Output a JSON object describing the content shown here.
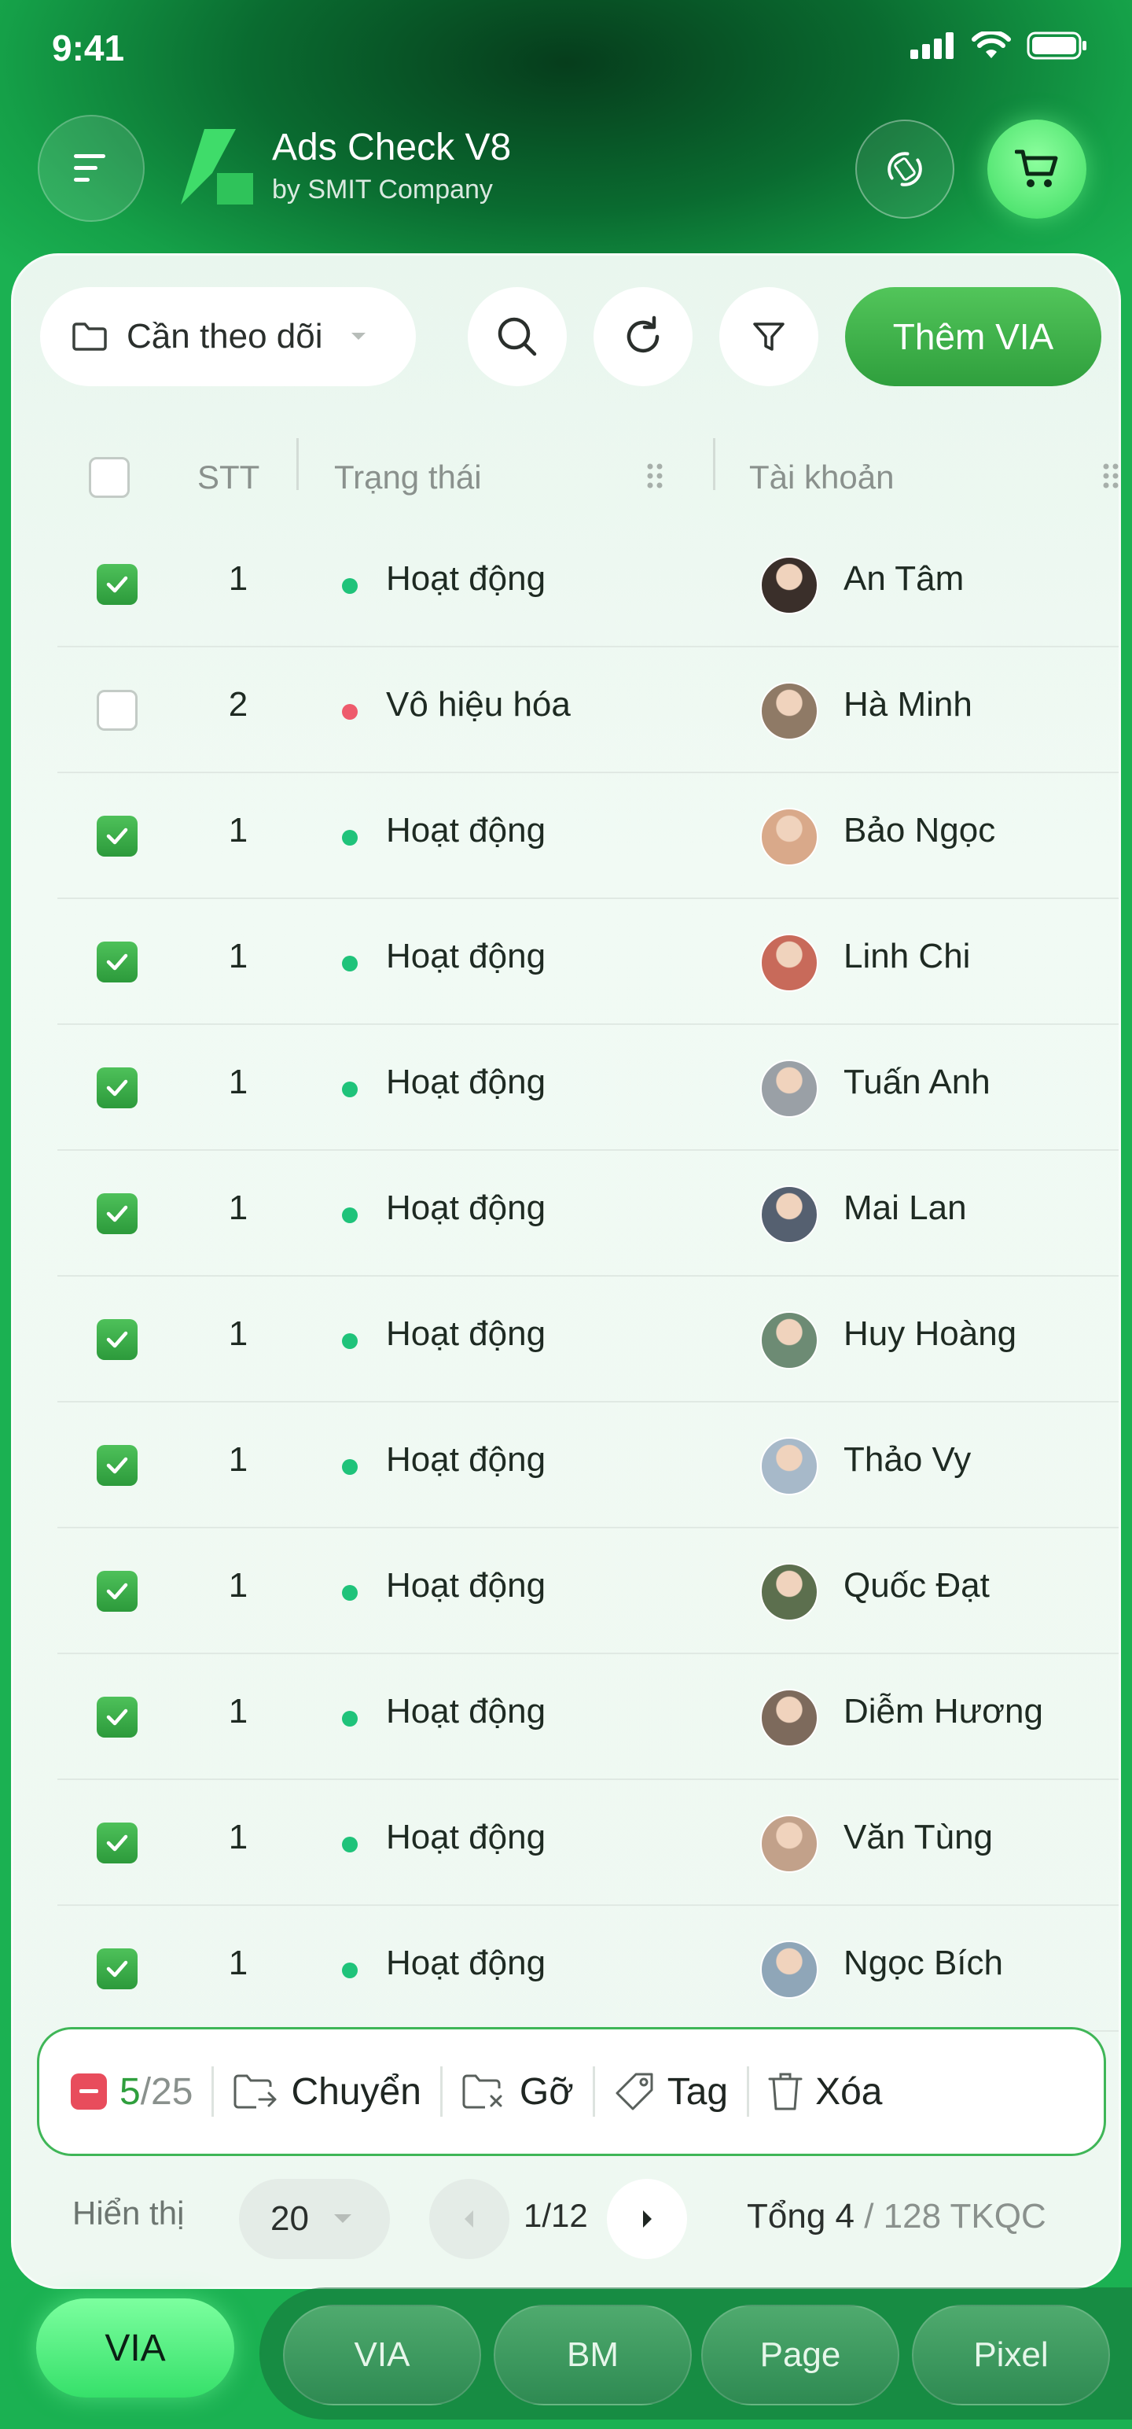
{
  "status_bar": {
    "time": "9:41"
  },
  "header": {
    "title": "Ads Check V8",
    "subtitle": "by SMIT Company",
    "brand_color": "#1bb152"
  },
  "toolbar": {
    "folder_label": "Cần theo dõi",
    "add_button": "Thêm VIA",
    "icons": [
      "folder-icon",
      "search-icon",
      "refresh-icon",
      "filter-icon"
    ]
  },
  "table": {
    "headers": {
      "stt": "STT",
      "status": "Trạng thái",
      "account": "Tài khoản"
    },
    "rows": [
      {
        "checked": true,
        "stt": "1",
        "status": "Hoạt động",
        "status_color": "#1fc37a",
        "name": "An Tâm"
      },
      {
        "checked": false,
        "stt": "2",
        "status": "Vô hiệu hóa",
        "status_color": "#ee5b6c",
        "name": "Hà Minh"
      },
      {
        "checked": true,
        "stt": "1",
        "status": "Hoạt động",
        "status_color": "#1fc37a",
        "name": "Bảo Ngọc"
      },
      {
        "checked": true,
        "stt": "1",
        "status": "Hoạt động",
        "status_color": "#1fc37a",
        "name": "Linh Chi"
      },
      {
        "checked": true,
        "stt": "1",
        "status": "Hoạt động",
        "status_color": "#1fc37a",
        "name": "Tuấn Anh"
      },
      {
        "checked": true,
        "stt": "1",
        "status": "Hoạt động",
        "status_color": "#1fc37a",
        "name": "Mai Lan"
      },
      {
        "checked": true,
        "stt": "1",
        "status": "Hoạt động",
        "status_color": "#1fc37a",
        "name": "Huy Hoàng"
      },
      {
        "checked": true,
        "stt": "1",
        "status": "Hoạt động",
        "status_color": "#1fc37a",
        "name": "Thảo Vy"
      },
      {
        "checked": true,
        "stt": "1",
        "status": "Hoạt động",
        "status_color": "#1fc37a",
        "name": "Quốc Đạt"
      },
      {
        "checked": true,
        "stt": "1",
        "status": "Hoạt động",
        "status_color": "#1fc37a",
        "name": "Diễm Hương"
      },
      {
        "checked": true,
        "stt": "1",
        "status": "Hoạt động",
        "status_color": "#1fc37a",
        "name": "Văn Tùng"
      },
      {
        "checked": true,
        "stt": "1",
        "status": "Hoạt động",
        "status_color": "#1fc37a",
        "name": "Ngọc Bích"
      }
    ]
  },
  "action_bar": {
    "selected": "5",
    "total": "/25",
    "move": "Chuyển",
    "remove": "Gỡ",
    "tag": "Tag",
    "delete": "Xóa"
  },
  "pagination": {
    "show_label": "Hiển thị",
    "page_size": "20",
    "page": "1/12",
    "total_prefix": "Tổng 4",
    "total_suffix": "/ 128 TKQC"
  },
  "bottom_nav": {
    "active": "VIA",
    "tabs": [
      "VIA",
      "BM",
      "Page",
      "Pixel"
    ]
  }
}
